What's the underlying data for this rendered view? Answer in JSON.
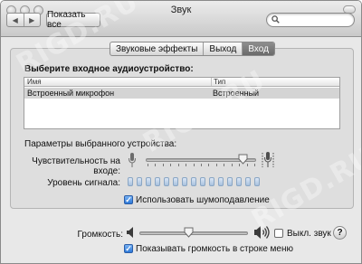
{
  "window": {
    "title": "Звук"
  },
  "toolbar": {
    "back_glyph": "◀",
    "forward_glyph": "▶",
    "show_all_label": "Показать все",
    "search_value": "",
    "search_placeholder": ""
  },
  "tabs": [
    {
      "label": "Звуковые эффекты",
      "active": false
    },
    {
      "label": "Выход",
      "active": false
    },
    {
      "label": "Вход",
      "active": true
    }
  ],
  "input": {
    "heading": "Выберите входное аудиоустройство:",
    "columns": [
      "Имя",
      "Тип"
    ],
    "rows": [
      {
        "name": "Встроенный микрофон",
        "type": "Встроенный",
        "selected": true
      }
    ]
  },
  "device_params": {
    "heading": "Параметры выбранного устройства:",
    "sensitivity_label": "Чувствительность на входе:",
    "sensitivity_level": 0.88,
    "signal_label": "Уровень сигнала:",
    "signal_bars_total": 15,
    "signal_bars_lit": 0,
    "noise_reduction_label": "Использовать шумоподавление",
    "noise_reduction_checked": true,
    "help_glyph": "?"
  },
  "output_volume": {
    "label": "Громкость:",
    "level": 0.45,
    "mute_label": "Выкл. звук",
    "mute_checked": false,
    "show_in_menu_label": "Показывать громкость в строке меню",
    "show_in_menu_checked": true
  },
  "icons": {
    "mic_low": "microphone-low-icon",
    "mic_high": "microphone-high-icon",
    "speaker_low": "speaker-low-icon",
    "speaker_high": "speaker-high-icon",
    "search": "magnifier-icon"
  },
  "colors": {
    "selected_tab": "#767676",
    "checkbox_on": "#2c78d8",
    "level_bar": "#a8c1dd"
  },
  "watermark": "RIGD.RU"
}
